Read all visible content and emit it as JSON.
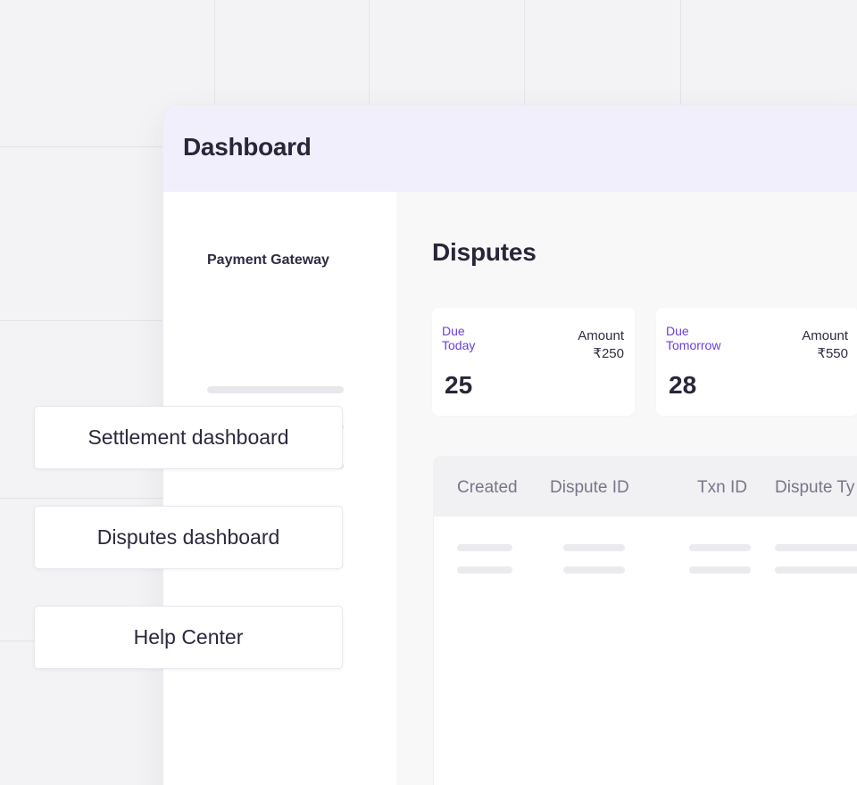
{
  "window": {
    "title": "Dashboard"
  },
  "sidebar": {
    "heading": "Payment Gateway",
    "placeholders": [
      {
        "kind": "loading-line"
      },
      {
        "kind": "loading-line"
      },
      {
        "kind": "loading-line"
      }
    ]
  },
  "main": {
    "title": "Disputes",
    "cards": [
      {
        "label": "Due\nToday",
        "amount_label": "Amount",
        "amount": "₹250",
        "count": "25"
      },
      {
        "label": "Due\nTomorrow",
        "amount_label": "Amount",
        "amount": "₹550",
        "count": "28"
      }
    ],
    "table": {
      "columns": [
        "Created",
        "Dispute ID",
        "Txn ID",
        "Dispute Ty"
      ],
      "rows": [
        {
          "state": "loading"
        },
        {
          "state": "loading"
        }
      ]
    }
  },
  "quick_links": [
    {
      "label": "Settlement dashboard"
    },
    {
      "label": "Disputes dashboard"
    },
    {
      "label": "Help Center"
    }
  ],
  "colors": {
    "background": "#f3f3f5",
    "header": "#f2effc",
    "accent": "#6b3de6",
    "text": "#27263a",
    "muted": "#777689"
  }
}
